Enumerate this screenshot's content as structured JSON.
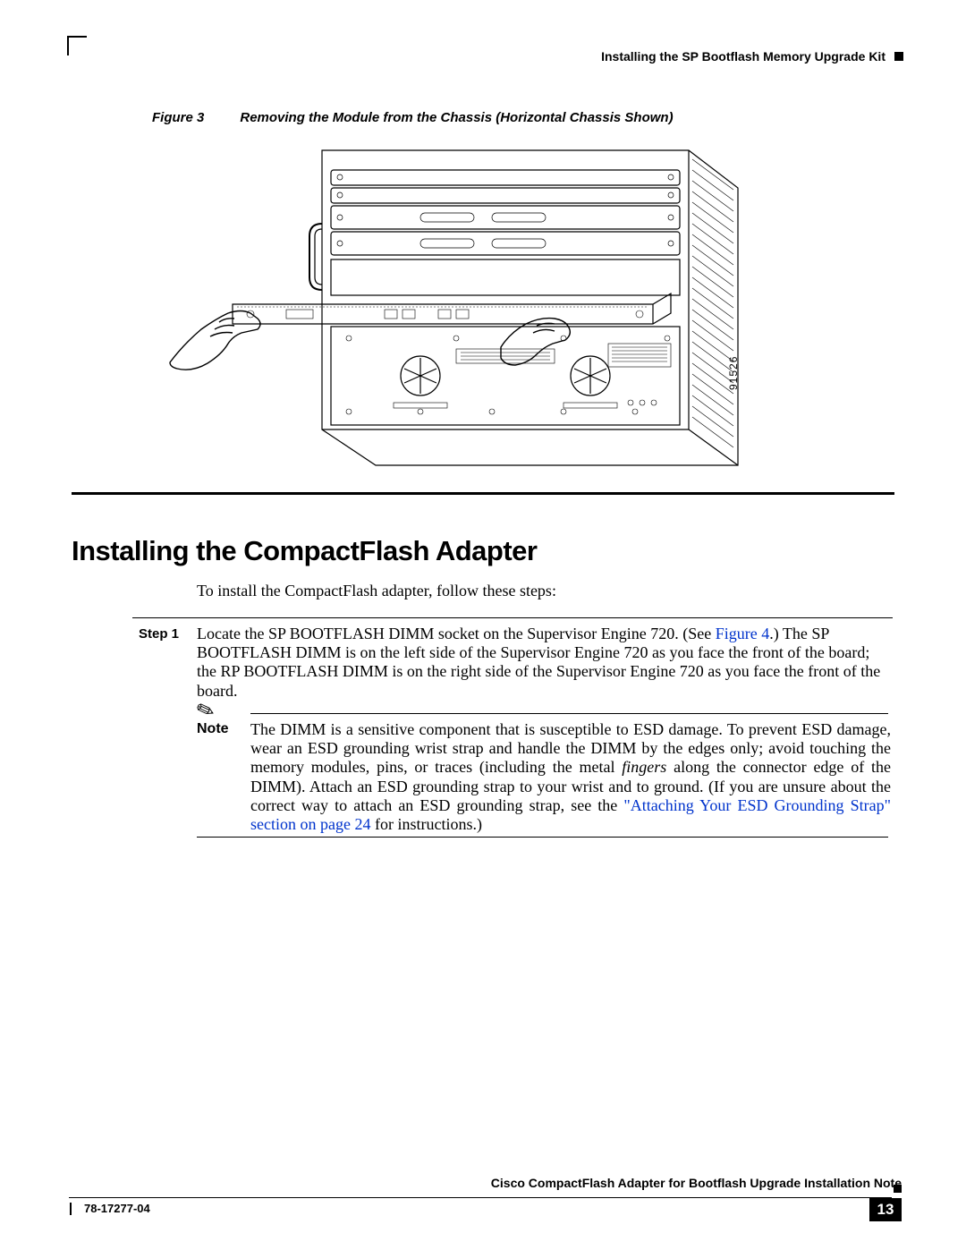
{
  "header": {
    "section_title": "Installing the SP Bootflash Memory Upgrade Kit"
  },
  "figure": {
    "label": "Figure 3",
    "caption": "Removing the Module from the Chassis (Horizontal Chassis Shown)",
    "side_num": "91526"
  },
  "section": {
    "title": "Installing the CompactFlash Adapter",
    "intro": "To install the CompactFlash adapter, follow these steps:"
  },
  "step1": {
    "label": "Step 1",
    "text_pre": "Locate the SP BOOTFLASH DIMM socket on the Supervisor Engine 720. (See ",
    "link": "Figure 4",
    "text_post": ".) The SP BOOTFLASH DIMM is on the left side of the Supervisor Engine 720 as you face the front of the board; the RP BOOTFLASH DIMM is on the right side of the Supervisor Engine 720 as you face the front of the board."
  },
  "note": {
    "label": "Note",
    "text1": "The DIMM is a sensitive component that is susceptible to ESD damage. To prevent ESD damage, wear an ESD grounding wrist strap and handle the DIMM by the edges only; avoid touching the memory modules, pins, or traces (including the metal ",
    "ital": "fingers",
    "text2": " along the connector edge of the DIMM). Attach an ESD grounding strap to your wrist and to ground. (If you are unsure about the correct way to attach an ESD grounding strap, see the ",
    "link": "\"Attaching Your ESD Grounding Strap\" section on page 24",
    "text3": " for instructions.)"
  },
  "footer": {
    "doc_title": "Cisco CompactFlash Adapter for Bootflash Upgrade Installation Note",
    "doc_num": "78-17277-04",
    "page": "13"
  }
}
